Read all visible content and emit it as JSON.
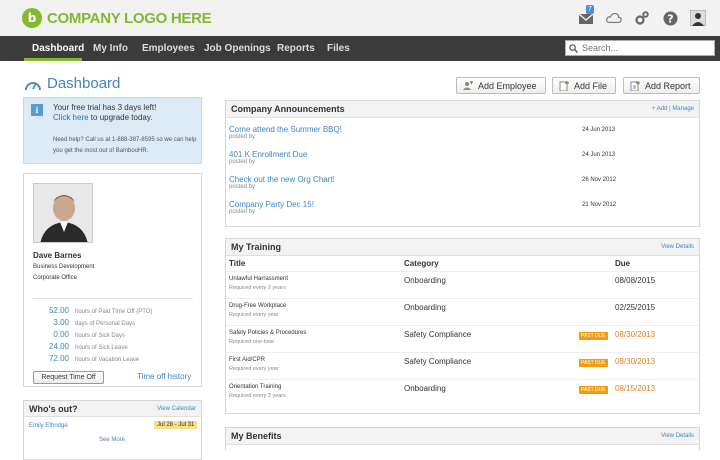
{
  "logo": {
    "mark": "b",
    "text": "COMPANY LOGO HERE"
  },
  "topicons": {
    "mail_badge": "7",
    "icons": [
      "inbox-icon",
      "cloud-icon",
      "gears-icon",
      "help-icon",
      "user-icon"
    ]
  },
  "nav": {
    "items": [
      "Dashboard",
      "My Info",
      "Employees",
      "Job Openings",
      "Reports",
      "Files"
    ],
    "active": "Dashboard"
  },
  "search": {
    "placeholder": "Search..."
  },
  "page": {
    "title": "Dashboard"
  },
  "actions": {
    "add_employee": "Add Employee",
    "add_file": "Add File",
    "add_report": "Add Report"
  },
  "trial": {
    "line1": "Your free trial has 3 days left!",
    "link": "Click here",
    "line2_rest": " to upgrade today.",
    "help": "Need help? Call us at 1-888-387-8595 so we can help you get the most out of BambooHR."
  },
  "profile": {
    "name": "Dave Barnes",
    "department": "Business Development",
    "division": "Corporate Office",
    "time_off": [
      {
        "value": "52.00",
        "desc": "hours of Paid Time Off (PTO)"
      },
      {
        "value": "3.00",
        "desc": "days of Personal Days"
      },
      {
        "value": "0.00",
        "desc": "hours of Sick Days"
      },
      {
        "value": "24.00",
        "desc": "hours of Sick Leave"
      },
      {
        "value": "72.00",
        "desc": "hours of Vacation Leave"
      }
    ],
    "request_btn": "Request Time Off",
    "history_link": "Time off history"
  },
  "whos_out": {
    "title": "Who's out?",
    "view_calendar": "View Calendar",
    "person": "Emily Ethridge",
    "dates": "Jul 28 - Jul 31",
    "see_more": "See More"
  },
  "announcements": {
    "title": "Company Announcements",
    "add": "+ Add",
    "sep": "|",
    "manage": "Manage",
    "items": [
      {
        "title": "Come attend the Summer BBQ!",
        "by": "posted by",
        "date": "24 Jun 2013"
      },
      {
        "title": "401 K Enrollment Due",
        "by": "posted by",
        "date": "24 Jun 2013"
      },
      {
        "title": "Check out the new Org Chart!",
        "by": "posted by",
        "date": "26 Nov 2012"
      },
      {
        "title": "Company Party Dec 15!",
        "by": "posted by",
        "date": "21 Nov 2012"
      }
    ]
  },
  "training": {
    "title": "My Training",
    "view": "View Details",
    "cols": [
      "Title",
      "Category",
      "Due"
    ],
    "rows": [
      {
        "title": "Unlawful Harrassment",
        "req": "Required every 2 years",
        "cat": "Onboarding",
        "due": "08/08/2015",
        "past": ""
      },
      {
        "title": "Drug-Free Workplace",
        "req": "Required every year",
        "cat": "Onboarding",
        "due": "02/25/2015",
        "past": ""
      },
      {
        "title": "Safety Policies & Procedures",
        "req": "Required one-time",
        "cat": "Safety Compliance",
        "due": "08/30/2013",
        "past": "PAST DUE"
      },
      {
        "title": "First Aid/CPR",
        "req": "Required every year",
        "cat": "Safety Compliance",
        "due": "08/30/2013",
        "past": "PAST DUE"
      },
      {
        "title": "Orientation Training",
        "req": "Required every 2 years",
        "cat": "Onboarding",
        "due": "08/15/2013",
        "past": "PAST DUE"
      }
    ]
  },
  "benefits": {
    "title": "My Benefits",
    "view": "View Details"
  }
}
